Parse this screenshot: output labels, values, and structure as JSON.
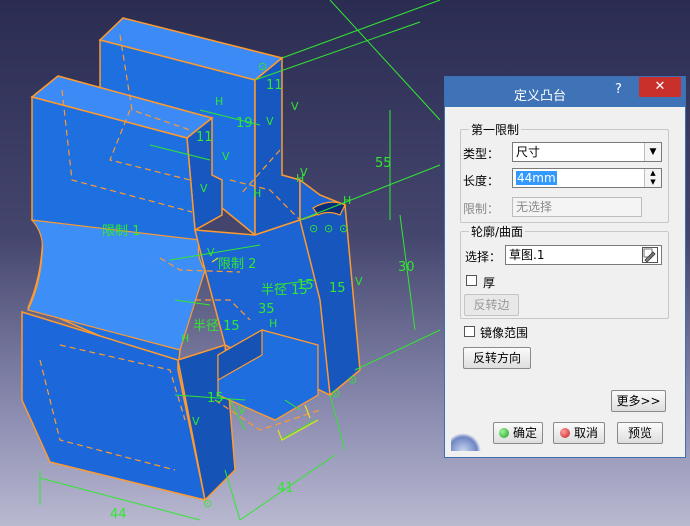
{
  "viewport": {
    "labels": {
      "dim_55": "55",
      "dim_30": "30",
      "dim_44": "44",
      "dim_41": "41",
      "dim_11a": "11",
      "dim_11b": "11",
      "dim_19": "19",
      "dim_15a": "15",
      "dim_15b": "15",
      "dim_15c": "15",
      "dim_35": "35",
      "limit1": "限制 1",
      "limit2": "限制 2",
      "radius_a": "半径 15",
      "radius_b": "半径 15"
    },
    "colors": {
      "solid": "#1e6fe0",
      "solid_light": "#2a80f0",
      "edge": "#ff9a2e",
      "dim": "#32e632"
    }
  },
  "dialog": {
    "title": "定义凸台",
    "help": "?",
    "close": "✕",
    "first_limit": {
      "legend": "第一限制",
      "type_label": "类型：",
      "type_value": "尺寸",
      "length_label": "长度：",
      "length_value": "44mm",
      "limit_label": "限制：",
      "limit_value": "无选择"
    },
    "profile": {
      "legend": "轮廓/曲面",
      "select_label": "选择：",
      "select_value": "草图.1",
      "thick_label": "厚",
      "reverse_side": "反转边"
    },
    "mirror_label": "镜像范围",
    "reverse_direction": "反转方向",
    "more": "更多>>",
    "ok": "确定",
    "cancel": "取消",
    "preview": "预览"
  }
}
